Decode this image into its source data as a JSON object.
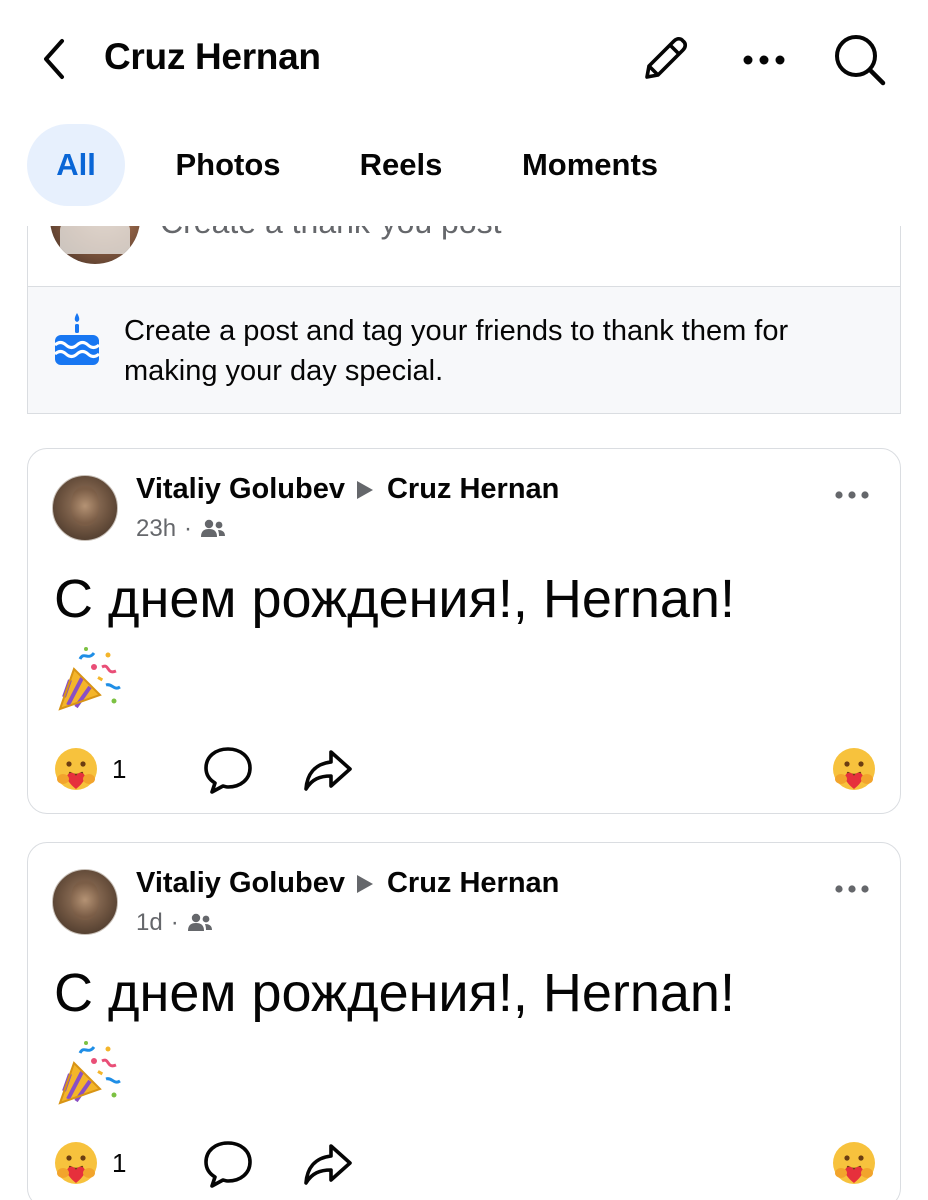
{
  "header": {
    "title": "Cruz Hernan",
    "icons": [
      "back-chevron-icon",
      "pencil-icon",
      "more-dots-icon",
      "search-icon"
    ]
  },
  "tabs": [
    {
      "label": "All",
      "active": true
    },
    {
      "label": "Photos",
      "active": false
    },
    {
      "label": "Reels",
      "active": false
    },
    {
      "label": "Moments",
      "active": false
    }
  ],
  "composer": {
    "prompt": "Create a thank-you post",
    "thank_message": "Create a post and tag your friends to thank them for making your day special.",
    "icon": "birthday-cake-icon"
  },
  "posts": [
    {
      "author": "Vitaliy Golubev",
      "target": "Cruz Hernan",
      "time": "23h",
      "audience_icon": "friends-icon",
      "text": "С днем рождения!, Hernan!",
      "emoji": "party-popper",
      "reaction_count": "1"
    },
    {
      "author": "Vitaliy Golubev",
      "target": "Cruz Hernan",
      "time": "1d",
      "audience_icon": "friends-icon",
      "text": "С днем рождения!, Hernan!",
      "emoji": "party-popper",
      "reaction_count": "1"
    }
  ],
  "colors": {
    "accent": "#0a66d6",
    "active_tab_bg": "#e7f0fd",
    "secondary_text": "#65676b",
    "border": "#dadde1",
    "cake_blue": "#1877f2"
  }
}
